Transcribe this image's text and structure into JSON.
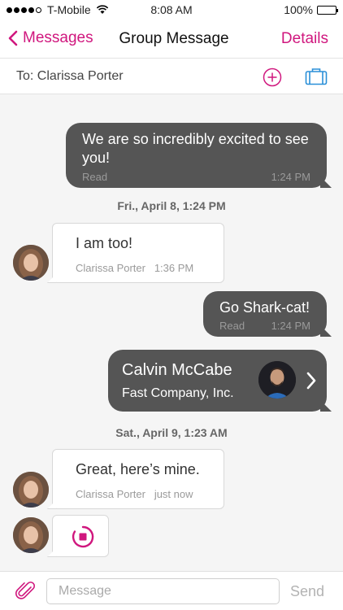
{
  "status_bar": {
    "carrier": "T-Mobile",
    "time": "8:08 AM",
    "battery": "100%"
  },
  "nav": {
    "back_label": "Messages",
    "title": "Group Message",
    "details_label": "Details"
  },
  "recipients": {
    "to_text": "To: Clarissa Porter"
  },
  "conversation": {
    "messages": [
      {
        "text": "We are so incredibly excited to see you!",
        "status": "Read",
        "time": "1:24 PM"
      },
      {
        "text": "I am too!",
        "sender": "Clarissa Porter",
        "time": "1:36 PM"
      },
      {
        "text": "Go Shark-cat!",
        "status": "Read",
        "time": "1:24 PM"
      },
      {
        "text": "Great, here’s mine.",
        "sender": "Clarissa Porter",
        "time": "just now"
      }
    ],
    "date_separators": [
      "Fri., April 8, 1:24 PM",
      "Sat., April 9, 1:23 AM"
    ],
    "contact_card": {
      "name": "Calvin McCabe",
      "company": "Fast Company, Inc."
    }
  },
  "composer": {
    "placeholder": "Message",
    "send_label": "Send"
  },
  "colors": {
    "accent": "#d0177e",
    "outgoing_bubble": "#555555",
    "icon_blue": "#2a8fd8"
  }
}
